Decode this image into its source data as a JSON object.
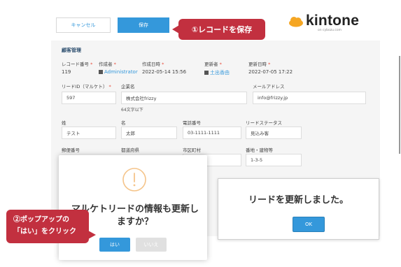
{
  "toolbar": {
    "cancel_label": "キャンセル",
    "save_label": "保存"
  },
  "annotation1": "①レコードを保存",
  "logo": {
    "name": "kintone",
    "sub": "on cybozu.com"
  },
  "form": {
    "section_title": "顧客管理",
    "record_no": {
      "label": "レコード番号",
      "value": "119"
    },
    "created_by": {
      "label": "作成者",
      "value": "Administrator"
    },
    "created_at": {
      "label": "作成日時",
      "value": "2022-05-14 15:56"
    },
    "updated_by": {
      "label": "更新者",
      "value": "土出香由"
    },
    "updated_at": {
      "label": "更新日時",
      "value": "2022-07-05 17:22"
    },
    "lead_id": {
      "label": "リードID（マルケト）",
      "value": "597"
    },
    "company": {
      "label": "企業名",
      "value": "株式会社frizzy",
      "hint": "64文字以下"
    },
    "email": {
      "label": "メールアドレス",
      "value": "info@frizzy.jp"
    },
    "last_name": {
      "label": "姓",
      "value": "テスト"
    },
    "first_name": {
      "label": "名",
      "value": "太郎"
    },
    "phone": {
      "label": "電話番号",
      "value": "03-1111-1111"
    },
    "lead_status": {
      "label": "リードステータス",
      "value": "見込み客"
    },
    "postal": {
      "label": "郵便番号"
    },
    "prefecture": {
      "label": "都道府県"
    },
    "city": {
      "label": "市区町村"
    },
    "street": {
      "label": "番地・建物等",
      "value": "1-3-5"
    },
    "required_mark": "*"
  },
  "confirm_dialog": {
    "message": "マルケトリードの情報も更新しますか？",
    "yes_label": "はい",
    "no_label": "いいえ"
  },
  "result_dialog": {
    "message": "リードを更新しました。",
    "ok_label": "OK"
  },
  "annotation2": {
    "line1": "②ポップアップの",
    "line2": "「はい」をクリック"
  },
  "colors": {
    "accent": "#3498db",
    "callout": "#c2303f",
    "logo_mark": "#f5a623"
  },
  "icons": {
    "warning": "warning-circle-icon",
    "user": "user-icon"
  }
}
